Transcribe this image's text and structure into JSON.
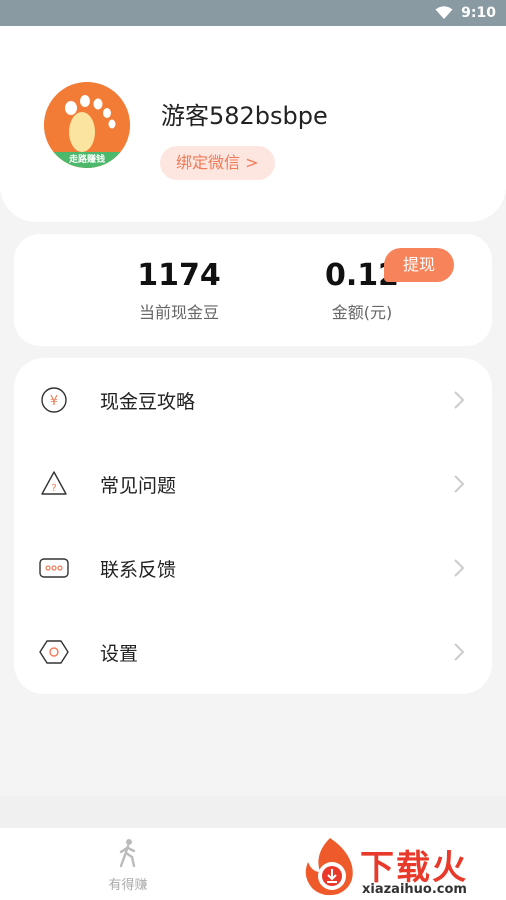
{
  "status_bar": {
    "time": "9:10"
  },
  "profile": {
    "username": "游客582bsbpe",
    "bind_wechat_label": "绑定微信 >",
    "avatar_band_text": "走路赚钱"
  },
  "stats": {
    "beans_value": "1174",
    "beans_label": "当前现金豆",
    "amount_value": "0.12",
    "amount_label": "金额(元)",
    "withdraw_label": "提现"
  },
  "menu": {
    "items": [
      {
        "label": "现金豆攻略",
        "icon": "yen-coin-icon"
      },
      {
        "label": "常见问题",
        "icon": "question-icon"
      },
      {
        "label": "联系反馈",
        "icon": "feedback-icon"
      },
      {
        "label": "设置",
        "icon": "settings-hexagon-icon"
      }
    ]
  },
  "bottom_nav": {
    "walk_label": "有得赚"
  },
  "watermark": {
    "text": "下载火",
    "url": "xiazaihuo.com"
  },
  "colors": {
    "accent": "#f6835a",
    "bind_bg": "#fde6e0",
    "status_bar": "#8a9aa2"
  }
}
